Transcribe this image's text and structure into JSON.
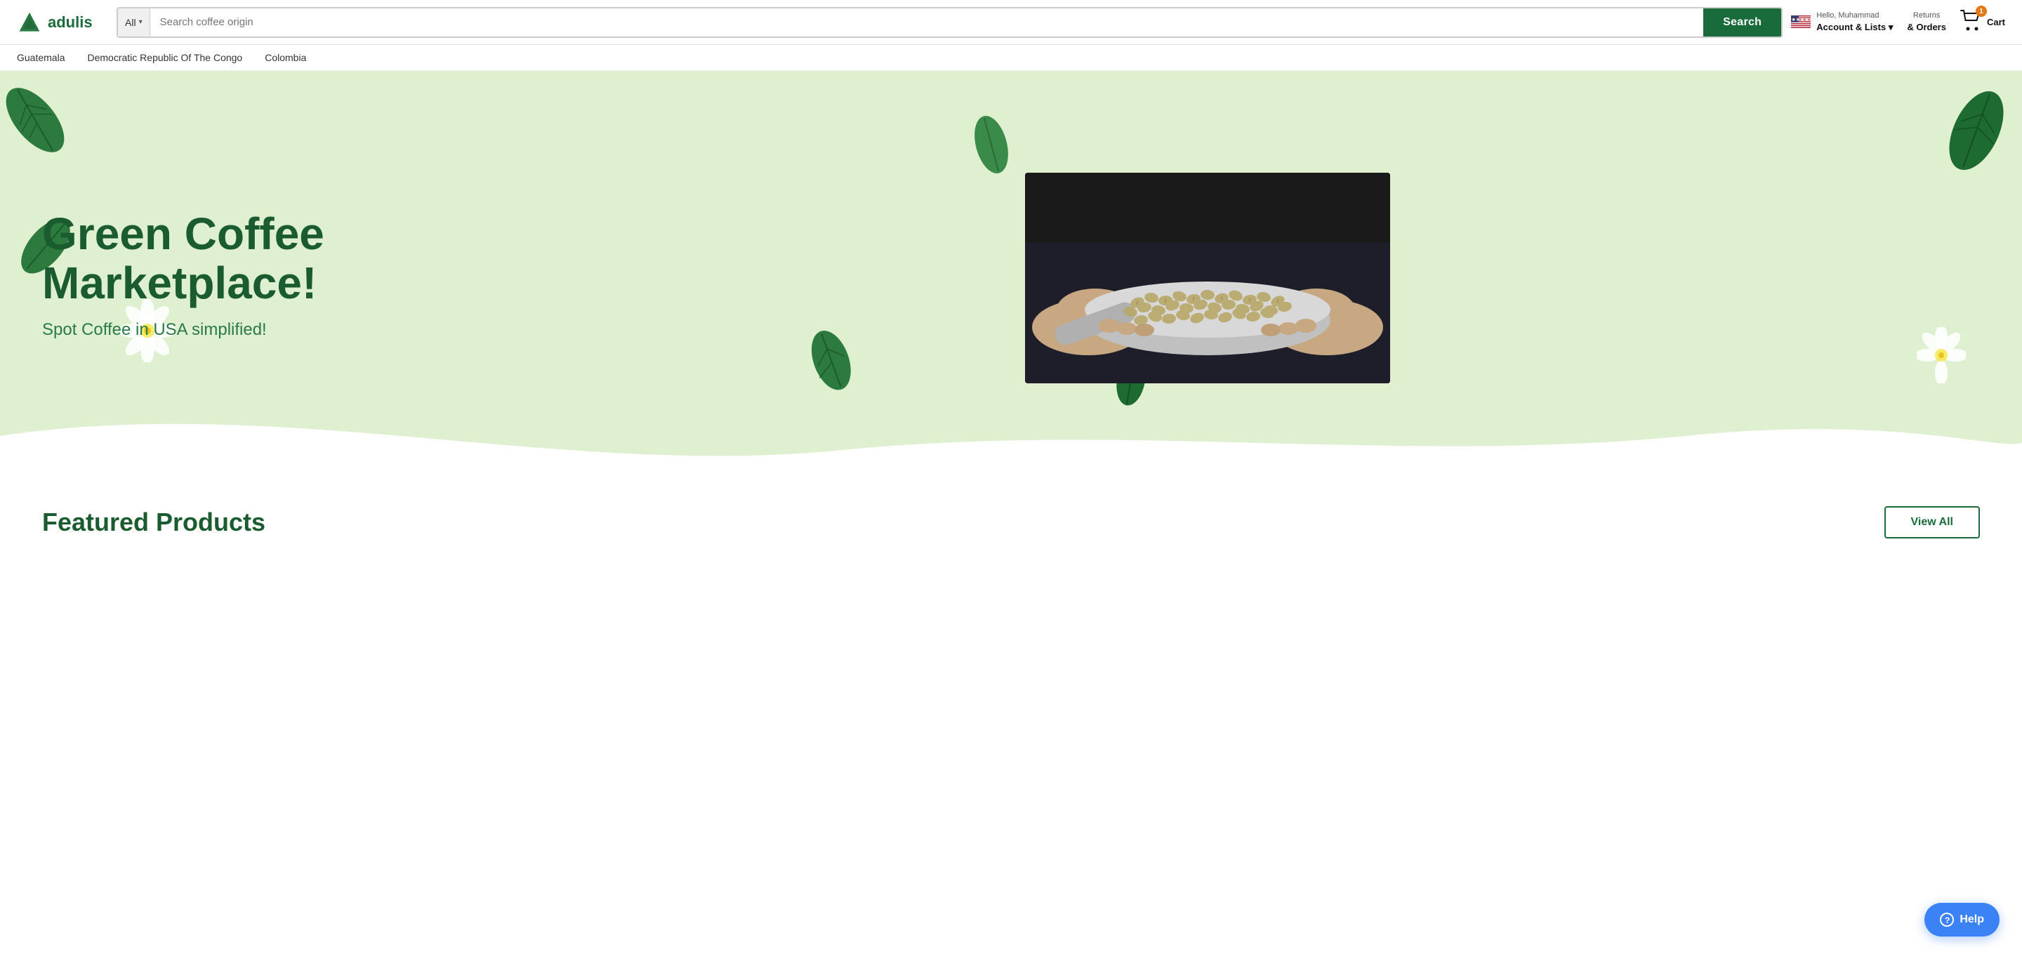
{
  "header": {
    "logo_text": "adulis",
    "search_category": "All",
    "search_placeholder": "Search coffee origin",
    "search_button_label": "Search",
    "account_hello": "Hello, Muhammad",
    "account_link": "Account & Lists ▾",
    "returns_label": "Returns",
    "orders_label": "& Orders",
    "cart_count": "1",
    "cart_label": "Cart"
  },
  "nav": {
    "items": [
      {
        "label": "Guatemala",
        "id": "nav-guatemala"
      },
      {
        "label": "Democratic Republic Of The Congo",
        "id": "nav-drc"
      },
      {
        "label": "Colombia",
        "id": "nav-colombia"
      }
    ]
  },
  "hero": {
    "title": "Green Coffee Marketplace!",
    "subtitle": "Spot Coffee in USA simplified!"
  },
  "featured": {
    "title": "Featured Products",
    "view_all_label": "View All"
  },
  "help": {
    "label": "Help"
  }
}
